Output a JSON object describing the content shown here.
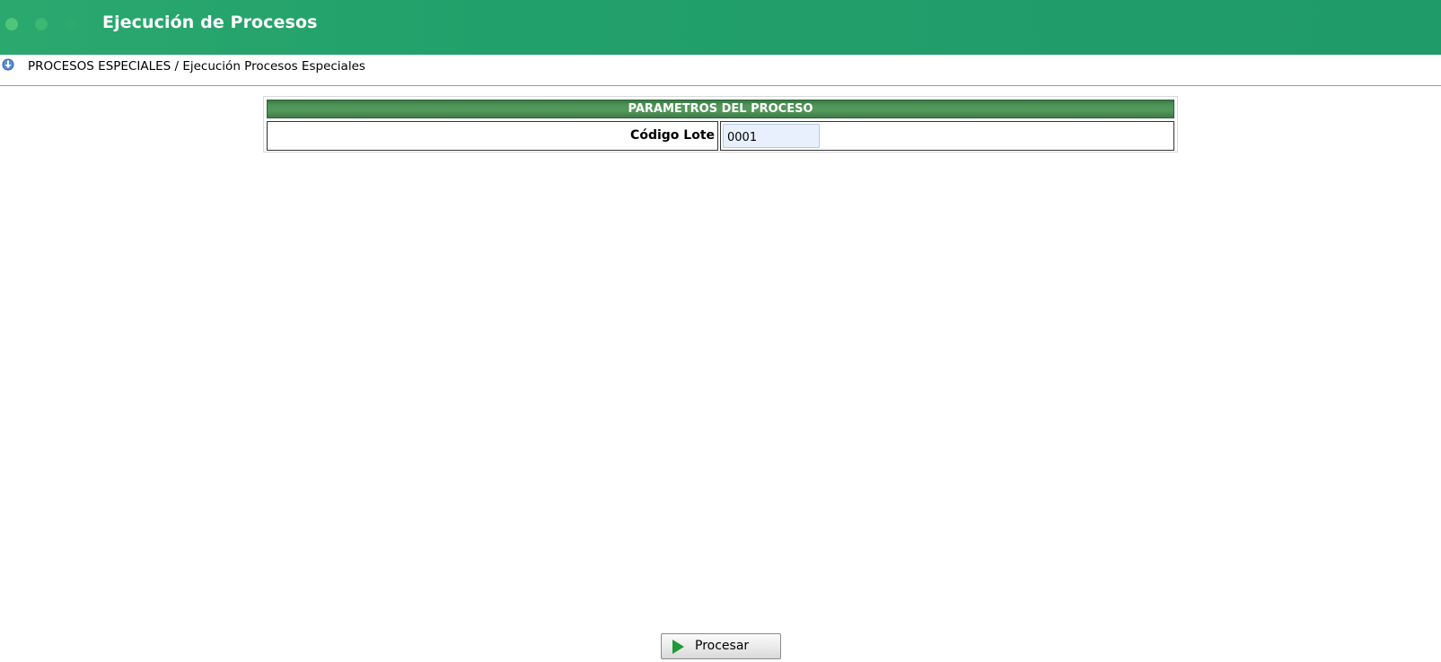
{
  "header": {
    "title": "Ejecución de Procesos"
  },
  "breadcrumb": {
    "icon": "info-download-icon",
    "path": "PROCESOS ESPECIALES / Ejecución Procesos Especiales"
  },
  "params": {
    "header": "PARAMETROS DEL PROCESO",
    "fields": [
      {
        "label": "Código Lote",
        "value": "0001"
      }
    ]
  },
  "actions": {
    "process_label": "Procesar",
    "process_icon": "play-icon"
  },
  "colors": {
    "header_bg": "#22a06b",
    "params_header_bg": "#4f9657",
    "input_bg": "#e8f0fe",
    "play_icon": "#1f9a36"
  }
}
